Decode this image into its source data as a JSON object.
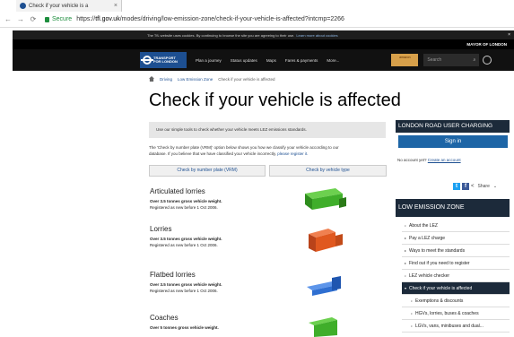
{
  "browser": {
    "tab_title": "Check if your vehicle is a",
    "tab_close": "×",
    "secure_label": "Secure",
    "url_scheme": "https://",
    "url_host": "tfl.gov.uk",
    "url_path": "/modes/driving/low-emission-zone/check-if-your-vehicle-is-affected?intcmp=2266"
  },
  "cookie_bar": {
    "text": "The TfL website uses cookies. By continuing to browse the site you are agreeing to their use.",
    "link": "Learn more about cookies",
    "close": "×"
  },
  "mayor_text": "MAYOR OF LONDON",
  "nav": {
    "logo_line1": "TRANSPORT",
    "logo_line2": "FOR LONDON",
    "items": [
      "Plan a journey",
      "Status updates",
      "Maps",
      "Fares & payments",
      "More..."
    ],
    "search_placeholder": "Search",
    "ad_text": "amazon"
  },
  "breadcrumb": [
    "Driving",
    "Low Emission Zone",
    "Check if your vehicle is affected"
  ],
  "page_title": "Check if your vehicle is affected",
  "intro": "Use our simple tools to check whether your vehicle meets LEZ emissions standards.",
  "para_line1": "The 'Check by number plate (VRM)' option below shows you how we classify your vehicle according to our",
  "para_line2": "database. If you believe that we have classified your vehicle incorrectly,",
  "para_link": "please register it.",
  "buttons": {
    "by_plate": "Check by number plate (VRM)",
    "by_type": "Check by vehicle type"
  },
  "vehicles": [
    {
      "name": "Articulated lorries",
      "weight": "Over 3.5 tonnes gross vehicle weight.",
      "registered": "Registered as new before 1 Oct 2006.",
      "color": "#3fae2a"
    },
    {
      "name": "Lorries",
      "weight": "Over 3.5 tonnes gross vehicle weight.",
      "registered": "Registered as new before 1 Oct 2006.",
      "color": "#e0581f"
    },
    {
      "name": "Flatbed lorries",
      "weight": "Over 3.5 tonnes gross vehicle weight.",
      "registered": "Registered as new before 1 Oct 2006.",
      "color": "#2f6fd1"
    },
    {
      "name": "Coaches",
      "weight": "Over 5 tonnes gross vehicle weight.",
      "registered": "",
      "color": "#3fae2a"
    }
  ],
  "sidebar": {
    "charging_heading": "LONDON ROAD USER CHARGING",
    "signin": "Sign in",
    "no_account": "No account yet?",
    "create_account": "Create an account",
    "share": "Share",
    "lez_heading": "LOW EMISSION ZONE",
    "lez_items": [
      "About the LEZ",
      "Pay a LEZ charge",
      "Ways to meet the standards",
      "Find out if you need to register",
      "LEZ vehicle checker",
      "Check if your vehicle is affected",
      "Exemptions & discounts",
      "HGVs, lorries, buses & coaches",
      "LGVs, vans, minibuses and dual..."
    ]
  }
}
